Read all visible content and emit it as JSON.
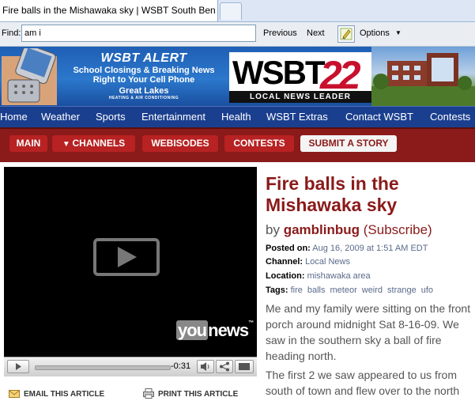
{
  "browser": {
    "tab_title": "Fire balls in the Mishawaka sky | WSBT South Bend - Y…",
    "find": {
      "label": "Find:",
      "value": "am i",
      "previous": "Previous",
      "next": "Next",
      "options": "Options"
    }
  },
  "banner": {
    "alert_logo": "WSBT ALERT",
    "alert_line1": "School Closings & Breaking News",
    "alert_line2": "Right to Your Cell Phone",
    "sponsor": "Great Lakes",
    "sponsor_sub": "HEATING & AIR CONDITIONING",
    "station": "WSBT",
    "channel_number": "22",
    "tagline": "LOCAL NEWS LEADER"
  },
  "main_nav": [
    "Home",
    "Weather",
    "Sports",
    "Entertainment",
    "Health",
    "WSBT Extras",
    "Contact WSBT",
    "Contests"
  ],
  "sub_nav": {
    "main": "MAIN",
    "channels": "CHANNELS",
    "webisodes": "WEBISODES",
    "contests": "CONTESTS",
    "submit": "SUBMIT A STORY"
  },
  "video": {
    "brand": "younews",
    "brand_you": "you",
    "brand_news": "news",
    "time_remaining": "-0:31"
  },
  "article": {
    "title": "Fire balls in the Mishawaka sky",
    "by": "by",
    "author": "gamblinbug",
    "subscribe": "(Subscribe)",
    "posted_label": "Posted on:",
    "posted_value": "Aug 16, 2009 at 1:51 AM EDT",
    "channel_label": "Channel:",
    "channel_value": "Local News",
    "location_label": "Location:",
    "location_value": "mishawaka area",
    "tags_label": "Tags:",
    "tags": [
      "fire",
      "balls",
      "meteor",
      "weird",
      "strange",
      "ufo"
    ],
    "paragraph1": "Me and my family were sitting on the front porch around midnight Sat 8-16-09. We saw in the southern sky a ball of fire heading north.",
    "paragraph2": "The first 2 we saw appeared to us from south of town and flew over to the north",
    "email": "EMAIL THIS ARTICLE",
    "print": "PRINT THIS ARTICLE"
  },
  "colors": {
    "brand_red": "#8b1a1a",
    "nav_blue": "#1b3f8f",
    "banner_blue": "#2b78cc"
  }
}
